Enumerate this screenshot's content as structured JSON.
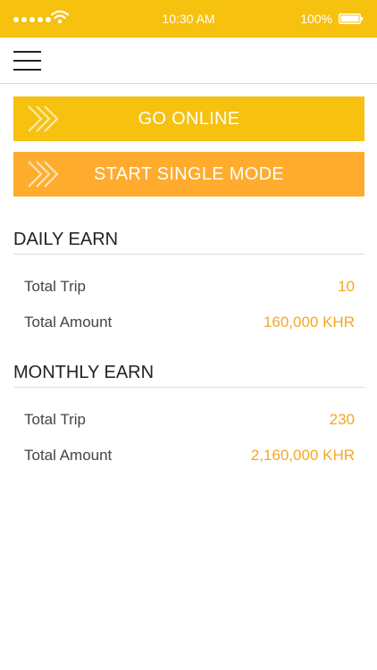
{
  "status_bar": {
    "time": "10:30 AM",
    "battery": "100%",
    "background": "#f6c10f",
    "icons": [
      "signal-dots-icon",
      "wifi-icon",
      "battery-icon"
    ]
  },
  "nav": {
    "menu_icon": "hamburger-menu-icon"
  },
  "actions": {
    "go_online": "GO ONLINE",
    "start_single_mode": "START SINGLE MODE",
    "go_online_color": "#f6c10f",
    "single_mode_color": "#ffac2e",
    "icon": "double-chevron-right-icon"
  },
  "daily": {
    "title": "DAILY EARN",
    "rows": [
      {
        "label": "Total Trip",
        "value": "10"
      },
      {
        "label": "Total Amount",
        "value": "160,000 KHR"
      }
    ]
  },
  "monthly": {
    "title": "MONTHLY EARN",
    "rows": [
      {
        "label": "Total Trip",
        "value": "230"
      },
      {
        "label": "Total Amount",
        "value": "2,160,000 KHR"
      }
    ]
  },
  "colors": {
    "accent": "#f6c10f",
    "value_text": "#f5a623"
  }
}
